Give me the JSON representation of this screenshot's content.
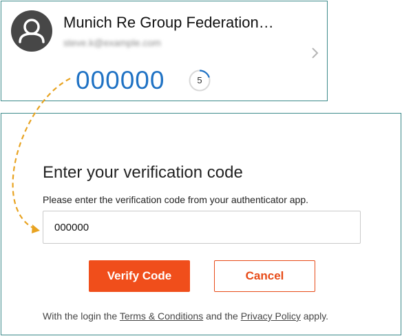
{
  "authenticator": {
    "account_name": "Munich Re Group Federation…",
    "account_email": "steve.k@example.com",
    "code": "000000",
    "timer": "5",
    "timer_progress": 0.2,
    "icons": {
      "avatar": "person-avatar-icon",
      "chevron": "chevron-right-icon",
      "timer": "countdown-ring-icon"
    }
  },
  "verify": {
    "title": "Enter your verification code",
    "instructions": "Please enter the verification code from your authenticator app.",
    "code_value": "000000",
    "verify_label": "Verify Code",
    "cancel_label": "Cancel",
    "legal": {
      "prefix": "With the login the",
      "terms": "Terms & Conditions",
      "middle": "and the",
      "privacy": "Privacy Policy",
      "suffix": "apply."
    }
  },
  "colors": {
    "accent_orange": "#f04e1b",
    "code_blue": "#1f72c4",
    "border_teal": "#3c8a8a",
    "arrow_yellow": "#e8a321"
  }
}
